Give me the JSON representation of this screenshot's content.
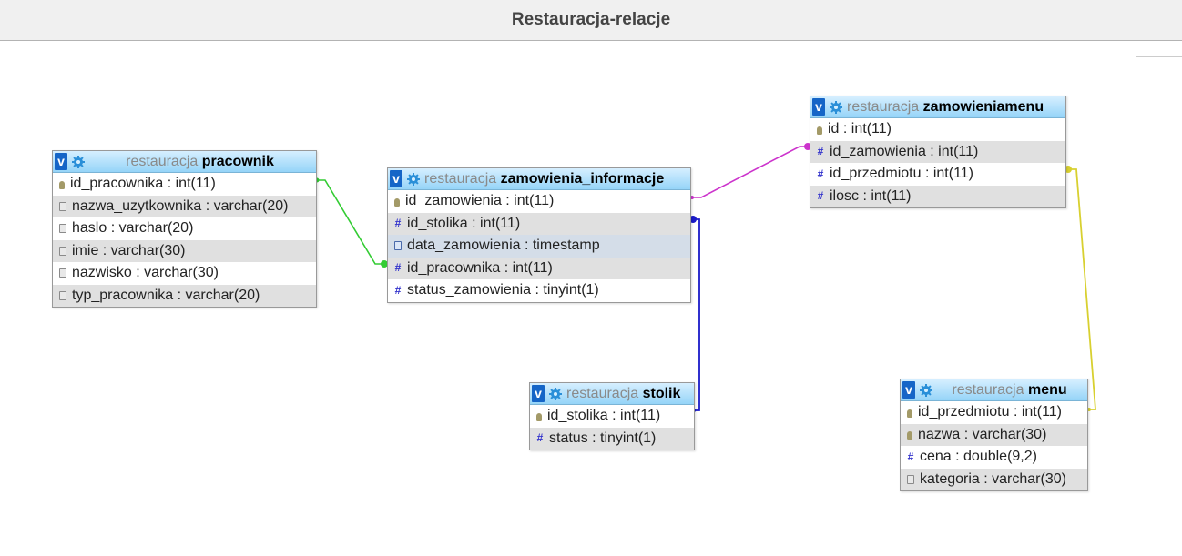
{
  "page": {
    "title": "Restauracja-relacje"
  },
  "colors": {
    "link_pracownik": "#33cc33",
    "link_zamowieniamenu": "#cc33cc",
    "link_stolik": "#1a1ac8",
    "link_menu": "#d8d030"
  },
  "tables": {
    "pracownik": {
      "db": "restauracja",
      "name": "pracownik",
      "columns": [
        {
          "label": "id_pracownika : int(11)",
          "icon": "key-icon"
        },
        {
          "label": "nazwa_uzytkownika : varchar(20)",
          "icon": "text-field-icon"
        },
        {
          "label": "haslo : varchar(20)",
          "icon": "text-field-icon"
        },
        {
          "label": "imie : varchar(30)",
          "icon": "text-field-icon"
        },
        {
          "label": "nazwisko : varchar(30)",
          "icon": "text-field-icon"
        },
        {
          "label": "typ_pracownika : varchar(20)",
          "icon": "text-field-icon"
        }
      ]
    },
    "zamowienia_informacje": {
      "db": "restauracja",
      "name": "zamowienia_informacje",
      "columns": [
        {
          "label": "id_zamowienia : int(11)",
          "icon": "key-icon"
        },
        {
          "label": "id_stolika : int(11)",
          "icon": "number-icon"
        },
        {
          "label": "data_zamowienia : timestamp",
          "icon": "date-icon"
        },
        {
          "label": "id_pracownika : int(11)",
          "icon": "number-icon"
        },
        {
          "label": "status_zamowienia : tinyint(1)",
          "icon": "number-icon"
        }
      ]
    },
    "zamowieniamenu": {
      "db": "restauracja",
      "name": "zamowieniamenu",
      "columns": [
        {
          "label": "id : int(11)",
          "icon": "key-icon"
        },
        {
          "label": "id_zamowienia : int(11)",
          "icon": "number-icon"
        },
        {
          "label": "id_przedmiotu : int(11)",
          "icon": "number-icon"
        },
        {
          "label": "ilosc : int(11)",
          "icon": "number-icon"
        }
      ]
    },
    "stolik": {
      "db": "restauracja",
      "name": "stolik",
      "columns": [
        {
          "label": "id_stolika : int(11)",
          "icon": "key-icon"
        },
        {
          "label": "status : tinyint(1)",
          "icon": "number-icon"
        }
      ]
    },
    "menu": {
      "db": "restauracja",
      "name": "menu",
      "columns": [
        {
          "label": "id_przedmiotu : int(11)",
          "icon": "key-icon"
        },
        {
          "label": "nazwa : varchar(30)",
          "icon": "key-icon"
        },
        {
          "label": "cena : double(9,2)",
          "icon": "number-icon"
        },
        {
          "label": "kategoria : varchar(30)",
          "icon": "text-field-icon"
        }
      ]
    }
  }
}
